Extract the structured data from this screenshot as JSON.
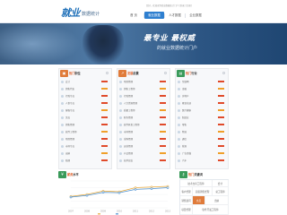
{
  "header": {
    "logo_main": "就业",
    "logo_sub": "数据统计",
    "tip": "您好，欢迎来到就业数据统计门户  [登录]  [注册]",
    "nav": [
      {
        "label": "首 页",
        "active": false
      },
      {
        "label": "就业数据",
        "active": true
      },
      {
        "label": "人才数据",
        "active": false
      },
      {
        "label": "企业数据",
        "active": false
      }
    ]
  },
  "banner": {
    "title": "最专业  最权威",
    "subtitle": "的就业数据统计门户"
  },
  "panels": [
    {
      "title_accent": "热门",
      "title_rest": "职位",
      "icon": "briefcase-icon",
      "color": "#e07b3a",
      "rows": [
        {
          "text": "会计"
        },
        {
          "text": "销售代表"
        },
        {
          "text": "行政专员"
        },
        {
          "text": "人事专员"
        },
        {
          "text": "客服专员"
        },
        {
          "text": "文员"
        },
        {
          "text": "销售经理"
        },
        {
          "text": "软件工程师"
        },
        {
          "text": "项目经理"
        },
        {
          "text": "市场专员"
        },
        {
          "text": "出纳"
        },
        {
          "text": "助理"
        }
      ]
    },
    {
      "title_accent": "发展",
      "title_rest": "前景",
      "icon": "chart-up-icon",
      "color": "#e07b3a",
      "rows": [
        {
          "text": "项目经理"
        },
        {
          "text": "销售工程师"
        },
        {
          "text": "行政经理"
        },
        {
          "text": "人力资源经理"
        },
        {
          "text": "质量工程师"
        },
        {
          "text": "财务经理"
        },
        {
          "text": "软件开发工程师"
        },
        {
          "text": "市场经理"
        },
        {
          "text": "采购经理"
        },
        {
          "text": "运营经理"
        },
        {
          "text": "产品经理"
        },
        {
          "text": "技术总监"
        }
      ]
    },
    {
      "title_accent": "热门",
      "title_rest": "行业",
      "icon": "building-icon",
      "color": "#3a9a5a",
      "rows": [
        {
          "text": "互联网"
        },
        {
          "text": "金融"
        },
        {
          "text": "房地产"
        },
        {
          "text": "教育培训"
        },
        {
          "text": "医疗健康"
        },
        {
          "text": "制造业"
        },
        {
          "text": "零售"
        },
        {
          "text": "物流"
        },
        {
          "text": "通信"
        },
        {
          "text": "能源"
        },
        {
          "text": "广告传媒"
        },
        {
          "text": "汽车"
        }
      ]
    }
  ],
  "chart_section": {
    "title_accent": "薪资",
    "title_rest": "水平",
    "icon": "coin-icon",
    "color": "#3a9a5a"
  },
  "chart_data": {
    "type": "line",
    "categories": [
      "2007",
      "2008",
      "2009",
      "2010",
      "2011",
      "2012",
      "2013"
    ],
    "series": [
      {
        "values": [
          34,
          40,
          50,
          48,
          60,
          62,
          64
        ],
        "color": "#e8a93a"
      },
      {
        "values": [
          32,
          37,
          46,
          45,
          55,
          57,
          60
        ],
        "color": "#4a8fd0"
      }
    ],
    "legend": [
      "",
      ""
    ],
    "ylim": [
      0,
      80
    ],
    "grid": true
  },
  "keywords": {
    "title_accent": "热门",
    "title_rest": "关键词",
    "icon": "key-icon",
    "color": "#3a9a5a",
    "cells": [
      {
        "text": "技术支持工程师"
      },
      {
        "text": "会计"
      },
      {
        "text": "客户经理"
      },
      {
        "text": "高级销售经理"
      },
      {
        "text": "总工程师"
      },
      {
        "text": "销售顾问"
      },
      {
        "text": "文员"
      },
      {
        "text": "出纳"
      },
      {
        "text": "项目经理"
      },
      {
        "text": "软件开发工程师"
      }
    ]
  }
}
